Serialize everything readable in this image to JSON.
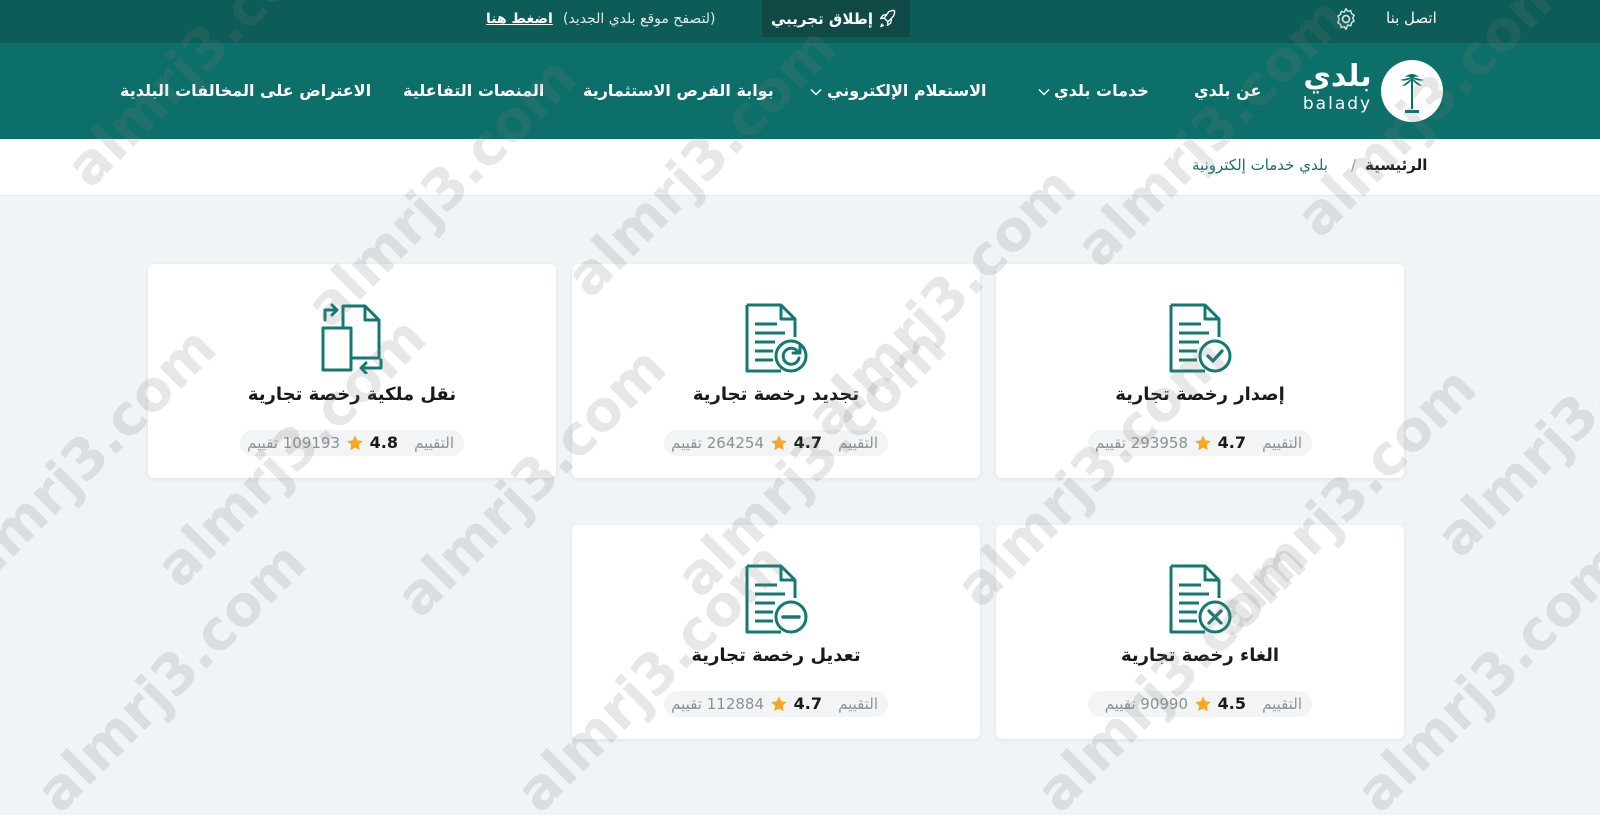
{
  "topbar": {
    "contact_label": "اتصل بنا",
    "beta_label": "إطلاق تجريبي",
    "beta_note": "(لتصفح موقع بلدي الجديد)",
    "beta_link": "اضغط هنا"
  },
  "logo": {
    "arabic": "بلدي",
    "english": "balady"
  },
  "nav": {
    "about": "عن بلدي",
    "services": "خدمات بلدي",
    "inquiry": "الاستعلام الإلكتروني",
    "investment": "بوابة الفرص الاستثمارية",
    "platforms": "المنصات التفاعلية",
    "objection": "الاعتراض على المخالفات البلدية"
  },
  "breadcrumb": {
    "home": "الرئيسية",
    "separator": "/",
    "current": "بلدي خدمات إلكترونية"
  },
  "rating_label": "التقييم",
  "cards": [
    {
      "title": "إصدار رخصة تجارية",
      "rating": "4.7",
      "count": "293958 تقييم",
      "icon": "doc-check-icon"
    },
    {
      "title": "تجديد رخصة تجارية",
      "rating": "4.7",
      "count": "264254 تقييم",
      "icon": "doc-renew-icon"
    },
    {
      "title": "نقل ملكية رخصة تجارية",
      "rating": "4.8",
      "count": "109193 تقييم",
      "icon": "doc-transfer-icon"
    },
    {
      "title": "الغاء رخصة تجارية",
      "rating": "4.5",
      "count": "90990 تقييم",
      "icon": "doc-cancel-icon"
    },
    {
      "title": "تعديل رخصة تجارية",
      "rating": "4.7",
      "count": "112884 تقييم",
      "icon": "doc-minus-icon"
    }
  ],
  "watermark": "almrj3.com",
  "colors": {
    "topbar": "#0c5c57",
    "navbar": "#0d6f69",
    "accent": "#137a72",
    "star": "#f5a623",
    "page_bg": "#f0f4f7"
  }
}
